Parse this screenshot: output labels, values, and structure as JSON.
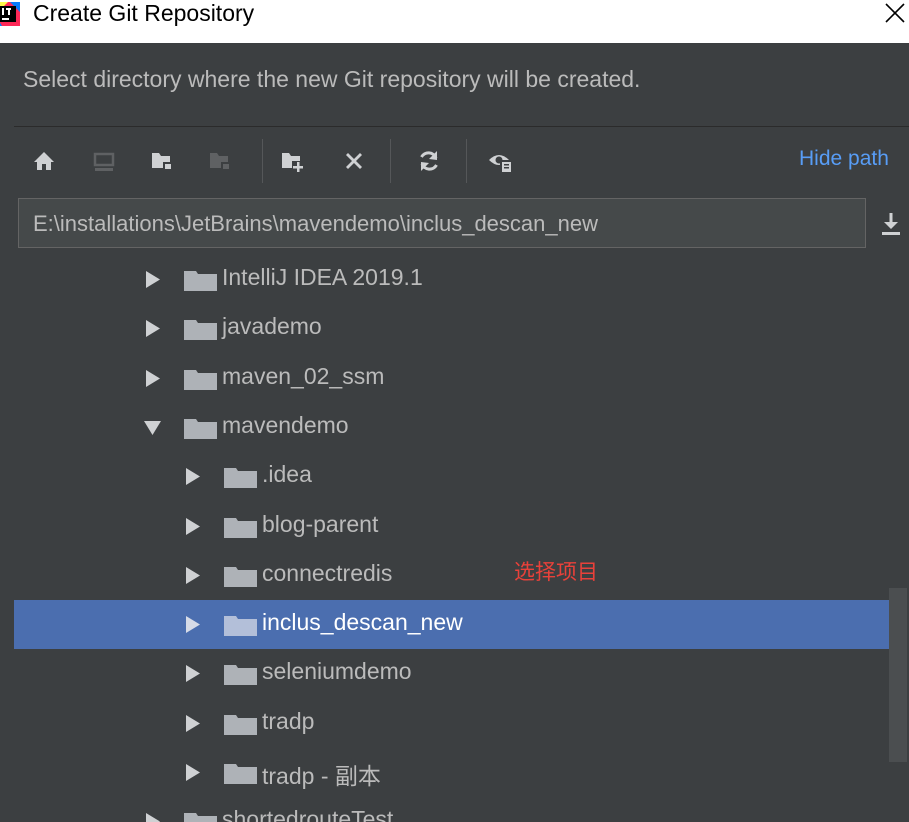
{
  "window": {
    "title": "Create Git Repository",
    "close_symbol": "✕"
  },
  "dialog": {
    "message": "Select directory where the new Git repository will be created."
  },
  "toolbar": {
    "icons": [
      "home-icon",
      "desktop-icon",
      "project-folder-icon",
      "module-folder-icon",
      "new-folder-icon",
      "delete-icon",
      "refresh-icon",
      "show-hidden-files-icon"
    ],
    "hide_path_label": "Hide path"
  },
  "path_field": {
    "value": "E:\\installations\\JetBrains\\mavendemo\\inclus_descan_new"
  },
  "tree": {
    "rows": [
      {
        "label": "IntelliJ IDEA 2019.1",
        "expanded": false,
        "selected": false
      },
      {
        "label": "javademo",
        "expanded": false,
        "selected": false
      },
      {
        "label": "maven_02_ssm",
        "expanded": false,
        "selected": false
      },
      {
        "label": "mavendemo",
        "expanded": true,
        "selected": false
      },
      {
        "label": ".idea",
        "expanded": false,
        "selected": false
      },
      {
        "label": "blog-parent",
        "expanded": false,
        "selected": false
      },
      {
        "label": "connectredis",
        "expanded": false,
        "selected": false
      },
      {
        "label": "inclus_descan_new",
        "expanded": false,
        "selected": true
      },
      {
        "label": "seleniumdemo",
        "expanded": false,
        "selected": false
      },
      {
        "label": "tradp",
        "expanded": false,
        "selected": false
      },
      {
        "label": "tradp - 副本",
        "expanded": false,
        "selected": false
      },
      {
        "label": "shortedrouteTest",
        "expanded": false,
        "selected": false
      }
    ]
  },
  "annotation": {
    "text": "选择项目"
  },
  "colors": {
    "background": "#3c3f41",
    "selection": "#4b6eaf",
    "link": "#589df6",
    "annotation": "#e9413a",
    "text": "#bbbbbb"
  }
}
